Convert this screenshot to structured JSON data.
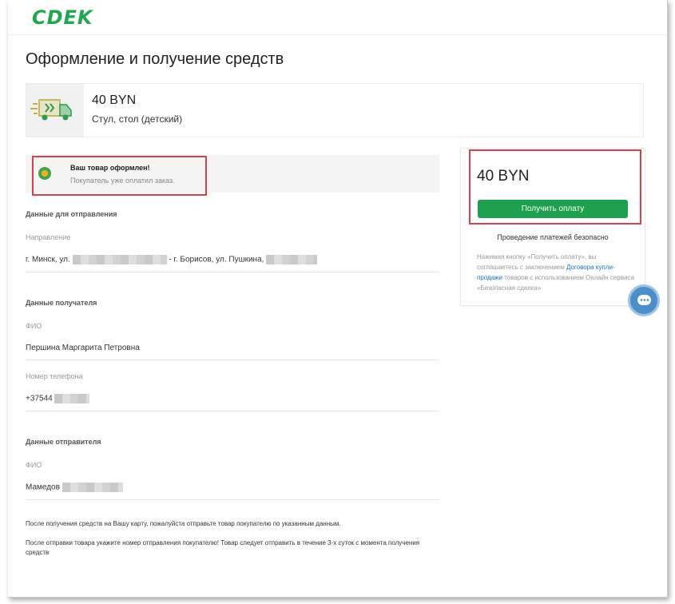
{
  "header": {
    "logo_text": "CDEK"
  },
  "page": {
    "title": "Оформление и получение средств"
  },
  "product": {
    "price": "40 BYN",
    "name": "Стул, стол (детский)",
    "thumb_icon": "delivery-truck-icon"
  },
  "status": {
    "title": "Ваш товар оформлен!",
    "subtitle": "Покупатель уже оплатил заказ."
  },
  "shipping": {
    "section_label": "Данные для отправления",
    "direction_label": "Направление",
    "direction_from": "г. Минск, ул.",
    "direction_to": "- г. Борисов, ул. Пушкина,"
  },
  "recipient": {
    "section_label": "Данные получателя",
    "name_label": "ФИО",
    "name_value": "Першина Маргарита Петровна",
    "phone_label": "Номер телефона",
    "phone_value": "+37544"
  },
  "sender": {
    "section_label": "Данные отправителя",
    "name_label": "ФИО",
    "name_value": "Мамедов"
  },
  "notes": {
    "line1": "После получения средств на Вашу карту, пожалуйста отправьте товар покупателю по указанным данным.",
    "line2": "После отправки товара укажите номер отправления покупателю! Товар следует отправить в течение 3-х суток с момента получения средств"
  },
  "payment": {
    "amount": "40 BYN",
    "button_label": "Получить оплату",
    "safe_text": "Проведение платежей безопасно",
    "terms_before": "Нажимая кнопку «Получить оплату», вы соглашаетесь с заключением ",
    "terms_link": "Договора купли-продажи",
    "terms_after": " товаров с использованием Онлайн сервиса «Безопасная сделка»"
  },
  "colors": {
    "brand": "#1fa84f",
    "button": "#1ea14e",
    "highlight": "#d9414c",
    "link": "#1a73c8"
  }
}
